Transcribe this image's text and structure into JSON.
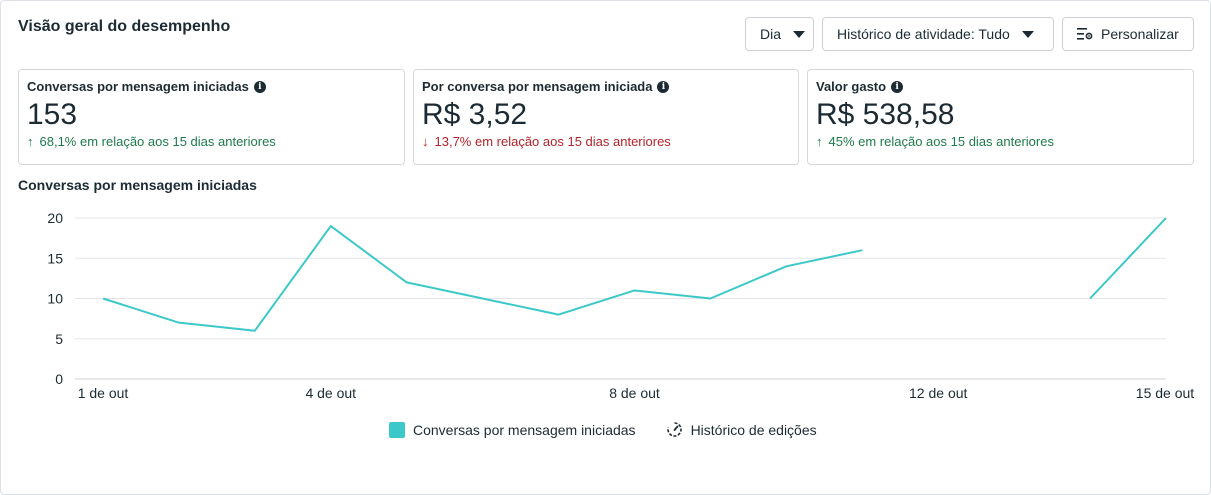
{
  "header": {
    "title": "Visão geral do desempenho",
    "period_label": "Dia",
    "activity_label": "Histórico de atividade: Tudo",
    "customize_label": "Personalizar"
  },
  "cards": [
    {
      "title": "Conversas por mensagem iniciadas",
      "value": "153",
      "delta_arrow": "↑",
      "delta_text": "68,1% em relação aos 15 dias anteriores",
      "direction": "up"
    },
    {
      "title": "Por conversa por mensagem iniciada",
      "value": "R$ 3,52",
      "delta_arrow": "↓",
      "delta_text": "13,7% em relação aos 15 dias anteriores",
      "direction": "down"
    },
    {
      "title": "Valor gasto",
      "value": "R$ 538,58",
      "delta_arrow": "↑",
      "delta_text": "45% em relação aos 15 dias anteriores",
      "direction": "up"
    }
  ],
  "chart_title": "Conversas por mensagem iniciadas",
  "legend": {
    "series_label": "Conversas por mensagem iniciadas",
    "history_label": "Histórico de edições"
  },
  "colors": {
    "series": "#3cc8c8",
    "grid": "#e4e6eb",
    "up": "#1e7a4c",
    "down": "#b2232a"
  },
  "chart_data": {
    "type": "line",
    "title": "Conversas por mensagem iniciadas",
    "xlabel": "",
    "ylabel": "",
    "ylim": [
      0,
      20
    ],
    "yticks": [
      0,
      5,
      10,
      15,
      20
    ],
    "xtick_labels": [
      {
        "day": 1,
        "label": "1 de out"
      },
      {
        "day": 4,
        "label": "4 de out"
      },
      {
        "day": 8,
        "label": "8 de out"
      },
      {
        "day": 12,
        "label": "12 de out"
      },
      {
        "day": 15,
        "label": "15 de out"
      }
    ],
    "grid": true,
    "series": [
      {
        "name": "Conversas por mensagem iniciadas",
        "points": [
          {
            "day": 1,
            "value": 10
          },
          {
            "day": 2,
            "value": 7
          },
          {
            "day": 3,
            "value": 6
          },
          {
            "day": 4,
            "value": 19
          },
          {
            "day": 5,
            "value": 12
          },
          {
            "day": 6,
            "value": 10
          },
          {
            "day": 7,
            "value": 8
          },
          {
            "day": 8,
            "value": 11
          },
          {
            "day": 9,
            "value": 10
          },
          {
            "day": 10,
            "value": 14
          },
          {
            "day": 11,
            "value": 16
          },
          {
            "day": 12,
            "value": null
          },
          {
            "day": 13,
            "value": null
          },
          {
            "day": 14,
            "value": 10
          },
          {
            "day": 15,
            "value": 20
          }
        ]
      }
    ]
  }
}
